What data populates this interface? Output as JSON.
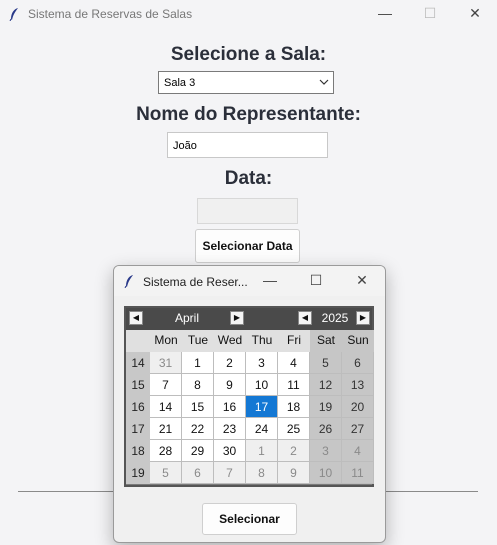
{
  "main_window": {
    "title": "Sistema de Reservas de Salas",
    "controls": {
      "minimize": "—",
      "maximize": "☐",
      "close": "✕"
    },
    "room_heading": "Selecione a Sala:",
    "room_selected": "Sala 3",
    "representative_heading": "Nome do Representante:",
    "representative_value": "João",
    "date_heading": "Data:",
    "date_value": "",
    "select_date_button": "Selecionar Data"
  },
  "date_dialog": {
    "title": "Sistema de Reser...",
    "controls": {
      "minimize": "—",
      "maximize": "☐",
      "close": "✕"
    },
    "calendar": {
      "prev_month": "◀",
      "month": "April",
      "next_month": "▶",
      "prev_year": "◀",
      "year": "2025",
      "next_year": "▶",
      "weekday_headers": [
        "Mon",
        "Tue",
        "Wed",
        "Thu",
        "Fri",
        "Sat",
        "Sun"
      ],
      "weeks": [
        {
          "number": "14",
          "days": [
            "31",
            "1",
            "2",
            "3",
            "4",
            "5",
            "6"
          ]
        },
        {
          "number": "15",
          "days": [
            "7",
            "8",
            "9",
            "10",
            "11",
            "12",
            "13"
          ]
        },
        {
          "number": "16",
          "days": [
            "14",
            "15",
            "16",
            "17",
            "18",
            "19",
            "20"
          ]
        },
        {
          "number": "17",
          "days": [
            "21",
            "22",
            "23",
            "24",
            "25",
            "26",
            "27"
          ]
        },
        {
          "number": "18",
          "days": [
            "28",
            "29",
            "30",
            "1",
            "2",
            "3",
            "4"
          ]
        },
        {
          "number": "19",
          "days": [
            "5",
            "6",
            "7",
            "8",
            "9",
            "10",
            "11"
          ]
        }
      ],
      "selected_day": "17",
      "selection_color": "#1478d4"
    },
    "select_button": "Selecionar"
  }
}
